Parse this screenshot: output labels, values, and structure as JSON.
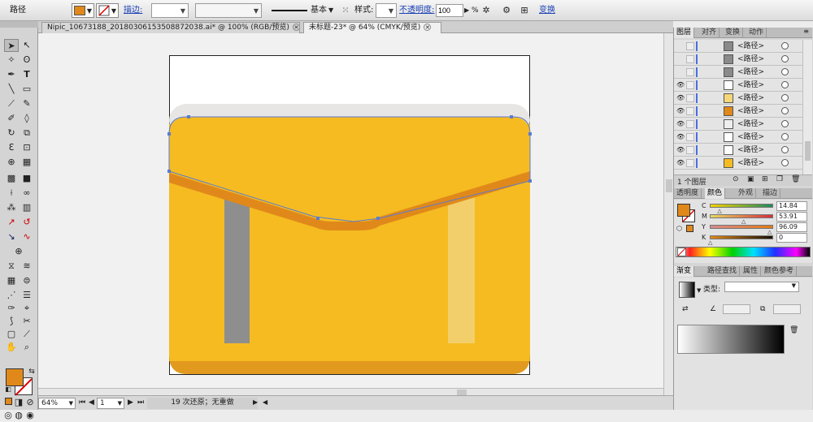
{
  "control_bar": {
    "selection_label": "路径",
    "stroke_label": "描边:",
    "stroke_profile": "基本",
    "style_label": "样式:",
    "opacity_label": "不透明度:",
    "opacity_value": "100",
    "opacity_unit": "%",
    "transform_label": "变换"
  },
  "document_tabs": [
    {
      "label": "Nipic_10673188_20180306153508872038.ai* @ 100% (RGB/预览)"
    },
    {
      "label": "未标题-23* @ 64% (CMYK/预览)"
    }
  ],
  "status_bar": {
    "zoom": "64%",
    "artboard": "1",
    "status_text": "19 次还原；无重做"
  },
  "layers_panel": {
    "tabs": [
      "图层",
      "对齐",
      "变换",
      "动作"
    ],
    "rows": [
      {
        "name": "<路径>",
        "visible": false,
        "thumb": "#8a8a8a"
      },
      {
        "name": "<路径>",
        "visible": false,
        "thumb": "#8a8a8a"
      },
      {
        "name": "<路径>",
        "visible": false,
        "thumb": "#8a8a8a"
      },
      {
        "name": "<路径>",
        "visible": true,
        "thumb": "#ffffff"
      },
      {
        "name": "<路径>",
        "visible": true,
        "thumb": "#f5d77a"
      },
      {
        "name": "<路径>",
        "visible": true,
        "thumb": "#E0891A"
      },
      {
        "name": "<路径>",
        "visible": true,
        "thumb": "#eeeeee"
      },
      {
        "name": "<路径>",
        "visible": true,
        "thumb": "#ffffff"
      },
      {
        "name": "<路径>",
        "visible": true,
        "thumb": "#ffffff"
      },
      {
        "name": "<路径>",
        "visible": true,
        "thumb": "#F5BB21"
      }
    ],
    "footer": "1 个图层"
  },
  "color_panel": {
    "tabs": [
      "透明度",
      "颜色",
      "外观",
      "描边"
    ],
    "fill_color": "#E0891A",
    "channels": [
      {
        "label": "C",
        "value": "14.84",
        "position": 0.15
      },
      {
        "label": "M",
        "value": "53.91",
        "position": 0.54
      },
      {
        "label": "Y",
        "value": "96.09",
        "position": 0.96
      },
      {
        "label": "K",
        "value": "0",
        "position": 0.0
      }
    ]
  },
  "gradient_panel": {
    "tabs": [
      "渐变",
      "路径查找",
      "属性",
      "颜色参考"
    ],
    "type_label": "类型:"
  },
  "artwork_colors": {
    "main_yellow": "#F5BB21",
    "flap_orange": "#E0891A",
    "base_orange": "#E29A1E",
    "back_gray": "#e8e6e4",
    "strap_gray": "#8e8e8e",
    "strap_light": "#f2cf6a"
  }
}
